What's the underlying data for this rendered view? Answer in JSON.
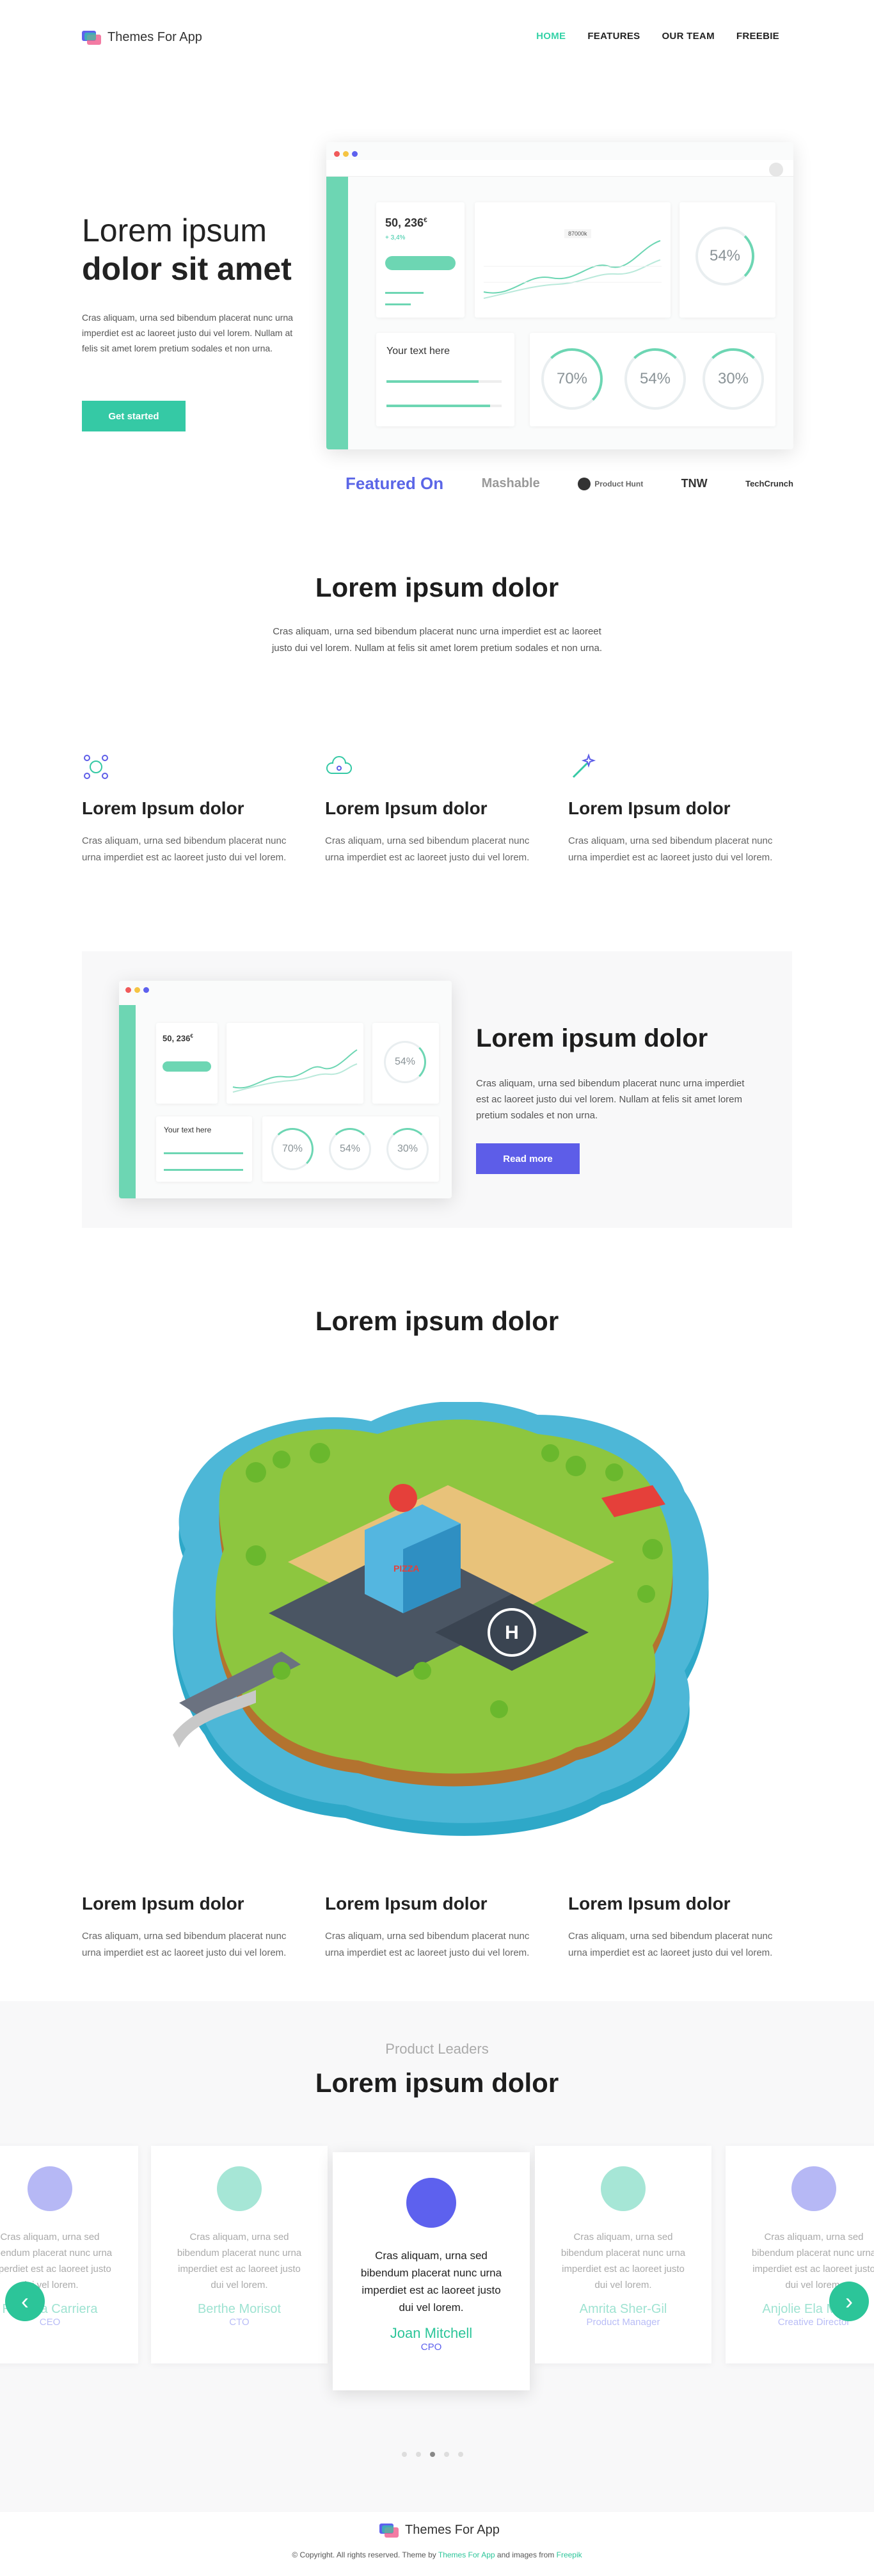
{
  "nav": {
    "brand": "Themes For App",
    "links": [
      "HOME",
      "FEATURES",
      "OUR TEAM",
      "FREEBIE"
    ]
  },
  "hero": {
    "title_light": "Lorem ipsum",
    "title_bold": "dolor sit amet",
    "text": "Cras aliquam, urna sed bibendum placerat nunc urna imperdiet est ac laoreet justo dui vel lorem. Nullam at felis sit amet lorem pretium sodales et non urna.",
    "cta": "Get started"
  },
  "dashboard": {
    "big_number": "50, 236",
    "big_number_sup": "€",
    "change": "+ 3,4%",
    "chart_tag": "87000k",
    "card_title": "Your text here",
    "rings": [
      "54%",
      "70%",
      "54%",
      "30%"
    ]
  },
  "featured": {
    "label": "Featured On",
    "press": [
      "Mashable",
      "Product Hunt",
      "TNW",
      "TechCrunch"
    ]
  },
  "section1": {
    "title": "Lorem ipsum dolor",
    "text": "Cras aliquam, urna sed bibendum placerat nunc urna imperdiet est ac laoreet justo dui vel lorem. Nullam at felis sit amet lorem pretium sodales et non urna."
  },
  "features": [
    {
      "icon": "network-icon",
      "title": "Lorem Ipsum dolor",
      "text": "Cras aliquam, urna sed bibendum placerat nunc urna imperdiet est ac laoreet justo dui vel lorem."
    },
    {
      "icon": "cloud-icon",
      "title": "Lorem Ipsum dolor",
      "text": "Cras aliquam, urna sed bibendum placerat nunc urna imperdiet est ac laoreet justo dui vel lorem."
    },
    {
      "icon": "magic-wand-icon",
      "title": "Lorem Ipsum dolor",
      "text": "Cras aliquam, urna sed bibendum placerat nunc urna imperdiet est ac laoreet justo dui vel lorem."
    }
  ],
  "promo": {
    "title": "Lorem ipsum dolor",
    "text": "Cras aliquam, urna sed bibendum placerat nunc urna imperdiet est ac laoreet justo dui vel lorem. Nullam at felis sit amet lorem pretium sodales et non urna.",
    "button": "Read more"
  },
  "section2": {
    "title": "Lorem ipsum dolor",
    "city_sign": "PIZZA"
  },
  "features2": [
    {
      "title": "Lorem Ipsum dolor",
      "text": "Cras aliquam, urna sed bibendum placerat nunc urna imperdiet est ac laoreet justo dui vel lorem."
    },
    {
      "title": "Lorem Ipsum dolor",
      "text": "Cras aliquam, urna sed bibendum placerat nunc urna imperdiet est ac laoreet justo dui vel lorem."
    },
    {
      "title": "Lorem Ipsum dolor",
      "text": "Cras aliquam, urna sed bibendum placerat nunc urna imperdiet est ac laoreet justo dui vel lorem."
    }
  ],
  "leaders": {
    "eyebrow": "Product Leaders",
    "title": "Lorem ipsum dolor",
    "cards": [
      {
        "name": "Roberta Carriera",
        "role": "CEO",
        "text": "Cras aliquam, urna sed bibendum placerat nunc urna imperdiet est ac laoreet justo dui vel lorem.",
        "avatar_color": "#b6b8f5",
        "name_color": "#9fe3d2",
        "role_color": "#b9bdf6"
      },
      {
        "name": "Berthe Morisot",
        "role": "CTO",
        "text": "Cras aliquam, urna sed bibendum placerat nunc urna imperdiet est ac laoreet justo dui vel lorem.",
        "avatar_color": "#a6e6d6",
        "name_color": "#9fe3d2",
        "role_color": "#b9bdf6"
      },
      {
        "name": "Joan Mitchell",
        "role": "CPO",
        "text": "Cras aliquam, urna sed bibendum placerat nunc urna imperdiet est ac laoreet justo dui vel lorem.",
        "avatar_color": "#5d61ee",
        "name_color": "#2cc599",
        "role_color": "#5d61ee"
      },
      {
        "name": "Amrita Sher-Gil",
        "role": "Product Manager",
        "text": "Cras aliquam, urna sed bibendum placerat nunc urna imperdiet est ac laoreet justo dui vel lorem.",
        "avatar_color": "#a6e6d6",
        "name_color": "#9fe3d2",
        "role_color": "#b9bdf6"
      },
      {
        "name": "Anjolie Ela Menon",
        "role": "Creative Director",
        "text": "Cras aliquam, urna sed bibendum placerat nunc urna imperdiet est ac laoreet justo dui vel lorem.",
        "avatar_color": "#b6b8f5",
        "name_color": "#9fe3d2",
        "role_color": "#b9bdf6"
      }
    ],
    "prev": "‹",
    "next": "›"
  },
  "footer": {
    "brand": "Themes For App",
    "copy_pre": "© Copyright. All rights reserved. Theme by ",
    "copy_link1": "Themes For App",
    "copy_mid": " and images from ",
    "copy_link2": "Freepik"
  },
  "colors": {
    "green": "#35c9a5",
    "blue": "#5d5de8",
    "accent_nav": "#35d2a7"
  }
}
